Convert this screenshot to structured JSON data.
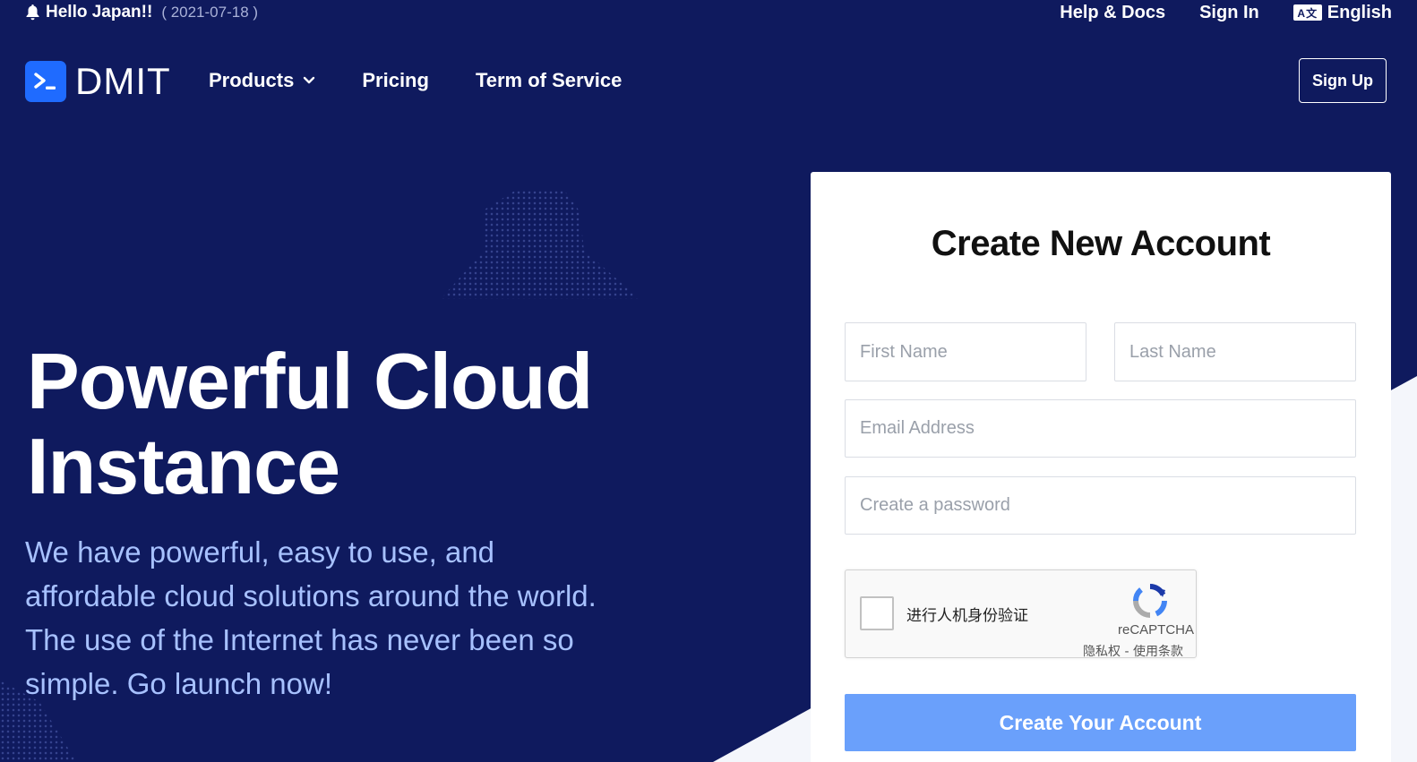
{
  "announcement": {
    "title": "Hello Japan!!",
    "date": "( 2021-07-18 )",
    "icon": "bell-icon"
  },
  "top_links": {
    "help": "Help & Docs",
    "signin": "Sign In",
    "language": "English",
    "language_icon": "translate-icon",
    "language_icon_glyph": "A文"
  },
  "brand": {
    "name": "DMIT",
    "logo_icon": "terminal-prompt-icon",
    "color": "#1f6bff"
  },
  "nav": {
    "products": "Products",
    "pricing": "Pricing",
    "tos": "Term of Service",
    "signup": "Sign Up"
  },
  "hero": {
    "title_line1": "Powerful Cloud",
    "title_line2": "Instance",
    "subtitle": "We have powerful, easy to use, and affordable cloud solutions around the world. The use of the Internet has never been so simple. Go launch now!"
  },
  "form": {
    "title": "Create New Account",
    "first_name_placeholder": "First Name",
    "last_name_placeholder": "Last Name",
    "email_placeholder": "Email Address",
    "password_placeholder": "Create a password",
    "captcha_label": "进行人机身份验证",
    "captcha_brand": "reCAPTCHA",
    "captcha_links": "隐私权 - 使用条款",
    "submit": "Create Your Account"
  },
  "colors": {
    "background": "#0f1a5e",
    "hero_subtitle": "#a7c1ff",
    "submit_button": "#6aa0fb"
  }
}
